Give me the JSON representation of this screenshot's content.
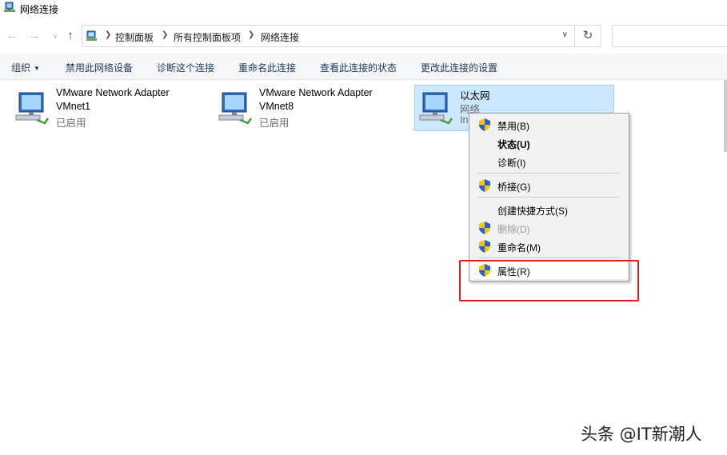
{
  "window": {
    "title": "网络连接"
  },
  "nav": {
    "breadcrumbs": [
      "控制面板",
      "所有控制面板项",
      "网络连接"
    ],
    "search_placeholder": ""
  },
  "commandbar": {
    "organize": "组织",
    "items": [
      "禁用此网络设备",
      "诊断这个连接",
      "重命名此连接",
      "查看此连接的状态",
      "更改此连接的设置"
    ]
  },
  "adapters": [
    {
      "name": "VMware Network Adapter",
      "line2": "VMnet1",
      "status": "已启用"
    },
    {
      "name": "VMware Network Adapter",
      "line2": "VMnet8",
      "status": "已启用"
    },
    {
      "name": "以太网",
      "line2": "网络",
      "status": "In"
    }
  ],
  "context_menu": {
    "items": [
      {
        "label": "禁用(B)",
        "shield": true
      },
      {
        "label": "状态(U)",
        "bold": true
      },
      {
        "label": "诊断(I)"
      },
      {
        "label": "桥接(G)",
        "shield": true
      },
      {
        "label": "创建快捷方式(S)"
      },
      {
        "label": "删除(D)",
        "shield": true,
        "disabled": true
      },
      {
        "label": "重命名(M)",
        "shield": true
      },
      {
        "label": "属性(R)",
        "shield": true,
        "highlighted": true
      }
    ]
  },
  "colors": {
    "selection_bg": "#cce8ff",
    "highlight_border": "#e81b1b",
    "command_text": "#1e395b"
  },
  "watermark": "头条 @IT新潮人"
}
